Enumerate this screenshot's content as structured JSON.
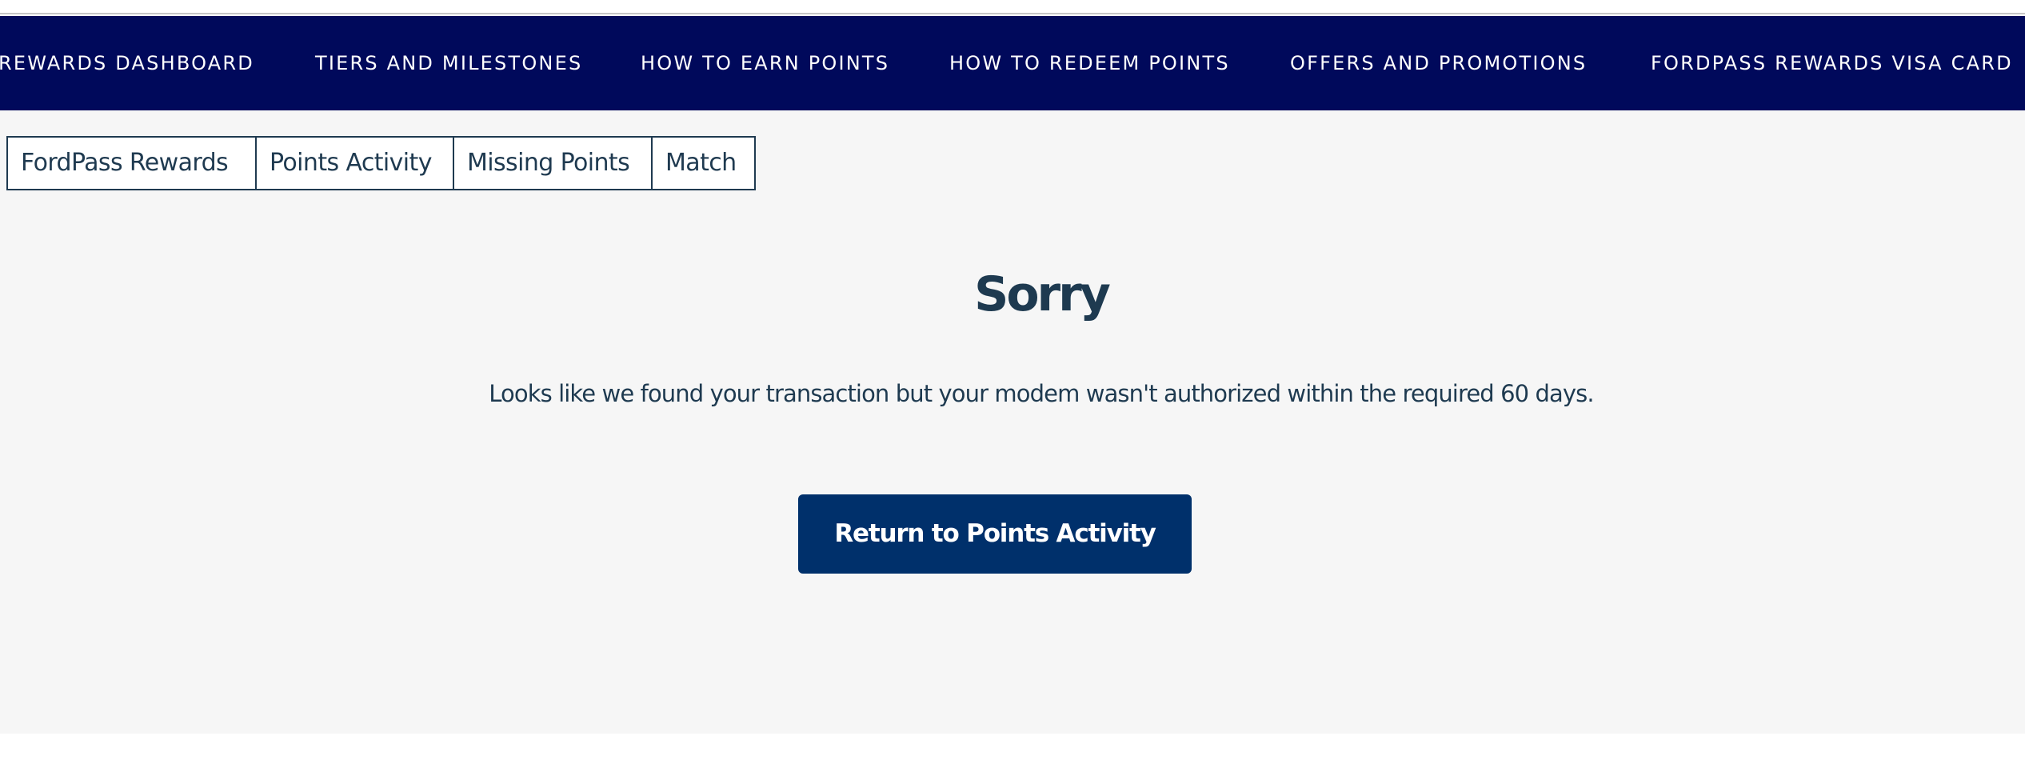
{
  "nav": {
    "items": [
      {
        "label": "REWARDS DASHBOARD"
      },
      {
        "label": "TIERS AND MILESTONES"
      },
      {
        "label": "HOW TO EARN POINTS"
      },
      {
        "label": "HOW TO REDEEM POINTS"
      },
      {
        "label": "OFFERS AND PROMOTIONS"
      },
      {
        "label": "FORDPASS REWARDS VISA CARD"
      }
    ]
  },
  "breadcrumb": {
    "items": [
      {
        "label": "FordPass Rewards"
      },
      {
        "label": "Points Activity"
      },
      {
        "label": "Missing Points"
      },
      {
        "label": "Match"
      }
    ]
  },
  "main": {
    "heading": "Sorry",
    "message": "Looks like we found your transaction but your modem wasn't authorized within the required 60 days.",
    "return_button_label": "Return to Points Activity"
  },
  "colors": {
    "nav_background": "#00095b",
    "text_primary": "#1e3a50",
    "button_background": "#00306b",
    "page_background": "#f6f6f6"
  }
}
